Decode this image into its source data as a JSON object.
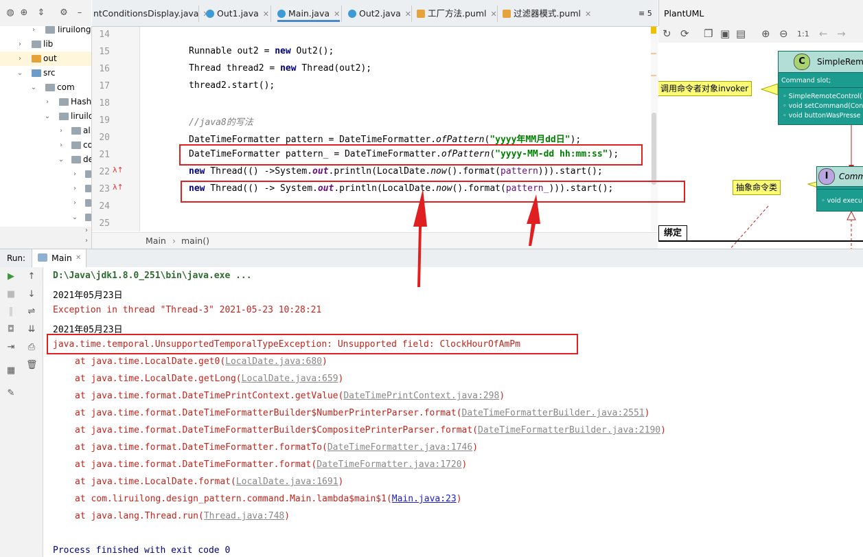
{
  "project_tree": {
    "items": [
      {
        "label": "liruilong"
      },
      {
        "label": "lib"
      },
      {
        "label": "out"
      },
      {
        "label": "src"
      },
      {
        "label": "com"
      },
      {
        "label": "Hash"
      },
      {
        "label": "liruilo"
      },
      {
        "label": "al"
      },
      {
        "label": "co"
      },
      {
        "label": "de"
      }
    ]
  },
  "editor_tabs": [
    {
      "label": "ntConditionsDisplay.java"
    },
    {
      "label": "Out1.java"
    },
    {
      "label": "Main.java"
    },
    {
      "label": "Out2.java"
    },
    {
      "label": "工厂方法.puml"
    },
    {
      "label": "过滤器模式.puml"
    }
  ],
  "tab_overflow": "≡ 5",
  "editor": {
    "line_numbers": [
      "14",
      "15",
      "16",
      "17",
      "18",
      "19",
      "20",
      "21",
      "22",
      "23",
      "24",
      "25"
    ],
    "code": {
      "l15": {
        "a": "Runnable out2 = ",
        "kw": "new",
        "b": " Out2();"
      },
      "l16": {
        "a": "Thread thread2 = ",
        "kw": "new",
        "b": " Thread(out2);"
      },
      "l17": {
        "a": "thread2.start();"
      },
      "l19": {
        "comment": "//java8的写法"
      },
      "l20": {
        "a": "DateTimeFormatter pattern = DateTimeFormatter.",
        "m": "ofPattern",
        "b": "(",
        "s": "\"yyyy年MM月dd日\"",
        "c": ");"
      },
      "l21": {
        "a": "DateTimeFormatter pattern_ = DateTimeFormatter.",
        "m": "ofPattern",
        "b": "(",
        "s": "\"yyyy-MM-dd hh:mm:ss\"",
        "c": ");"
      },
      "l22": {
        "kw": "new",
        "a": " Thread(() ->System.",
        "f": "out",
        "b": ".println(LocalDate.",
        "m": "now",
        "c": "().format(",
        "p": "pattern",
        "d": "))).start();"
      },
      "l23": {
        "kw": "new",
        "a": " Thread(() -> System.",
        "f": "out",
        "b": ".println(LocalDate.",
        "m": "now",
        "c": "().format(",
        "p": "pattern_",
        "d": "))).start();"
      }
    },
    "breadcrumb": {
      "a": "Main",
      "b": "main()"
    }
  },
  "plantuml": {
    "title": "PlantUML",
    "class1": {
      "badge": "C",
      "name": "SimpleRem",
      "field": "Command slot;",
      "m1": "SimpleRemoteControl(",
      "m2": "void setCommand(Con",
      "m3": "void buttonWasPresse"
    },
    "class2": {
      "badge": "I",
      "name": "Comm",
      "m1": "void execu"
    },
    "note1": "调用命令者对象invoker",
    "note2": "抽象命令类",
    "tab_label": "绑定"
  },
  "run": {
    "label": "Run:",
    "tab": "Main"
  },
  "console": {
    "cmd": "D:\\Java\\jdk1.8.0_251\\bin\\java.exe ...",
    "out1": "2021年05月23日",
    "exc": "Exception in thread \"Thread-3\" 2021-05-23 10:28:21",
    "out2": "2021年05月23日",
    "err": "java.time.temporal.UnsupportedTemporalTypeException: Unsupported field: ClockHourOfAmPm",
    "trace": [
      {
        "at": "at java.time.LocalDate.get0(",
        "link": "LocalDate.java:680",
        "end": ")"
      },
      {
        "at": "at java.time.LocalDate.getLong(",
        "link": "LocalDate.java:659",
        "end": ")"
      },
      {
        "at": "at java.time.format.DateTimePrintContext.getValue(",
        "link": "DateTimePrintContext.java:298",
        "end": ")"
      },
      {
        "at": "at java.time.format.DateTimeFormatterBuilder$NumberPrinterParser.format(",
        "link": "DateTimeFormatterBuilder.java:2551",
        "end": ")"
      },
      {
        "at": "at java.time.format.DateTimeFormatterBuilder$CompositePrinterParser.format(",
        "link": "DateTimeFormatterBuilder.java:2190",
        "end": ")"
      },
      {
        "at": "at java.time.format.DateTimeFormatter.formatTo(",
        "link": "DateTimeFormatter.java:1746",
        "end": ")"
      },
      {
        "at": "at java.time.format.DateTimeFormatter.format(",
        "link": "DateTimeFormatter.java:1720",
        "end": ")"
      },
      {
        "at": "at java.time.LocalDate.format(",
        "link": "LocalDate.java:1691",
        "end": ")"
      },
      {
        "at": "at com.liruilong.design_pattern.command.Main.lambda$main$1(",
        "link": "Main.java:23",
        "end": ")"
      },
      {
        "at": "at java.lang.Thread.run(",
        "link": "Thread.java:748",
        "end": ")"
      }
    ],
    "exit": "Process finished with exit code 0"
  }
}
